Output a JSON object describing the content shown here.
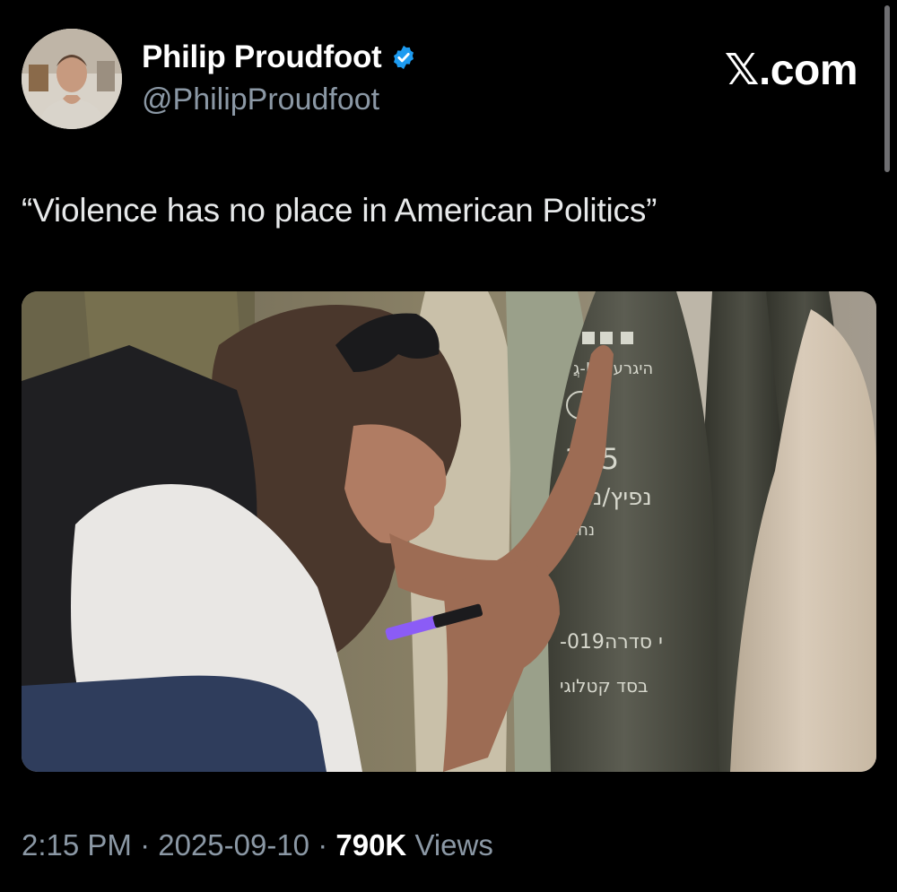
{
  "author": {
    "display_name": "Philip Proudfoot",
    "handle": "@PhilipProudfoot",
    "verified_icon": "verified-badge-icon"
  },
  "brand": {
    "text": "𝕏.com"
  },
  "tweet": {
    "text": "“Violence has no place in American Politics”"
  },
  "media": {
    "shell_markings": {
      "line1": "גֲ-HE היגרע",
      "line2": "155",
      "line3": "נפיץ/מטב",
      "line4": "נחבה",
      "line5": "-019י סדרה",
      "line6": "בסד קטלוגי"
    },
    "marker_color": "#8b5cf6"
  },
  "meta": {
    "time": "2:15 PM",
    "separator": " · ",
    "date": "2025-09-10",
    "views_count": "790K",
    "views_label": "Views"
  },
  "colors": {
    "background": "#000000",
    "primary_text": "#e7e9ea",
    "secondary_text": "#8b98a5",
    "verified": "#1d9bf0"
  }
}
